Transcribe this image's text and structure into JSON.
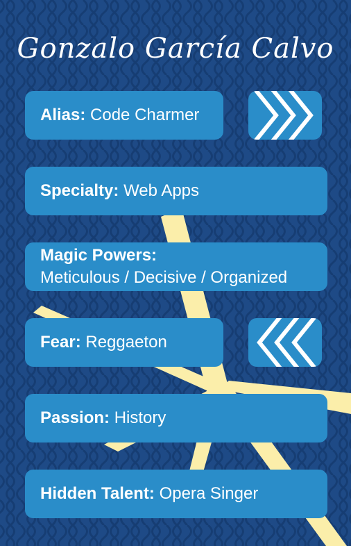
{
  "title": "Gonzalo García Calvo",
  "colors": {
    "background": "#1e4a86",
    "pattern": "#163d73",
    "card": "#2a8dc9",
    "stripe": "#fbeeaa",
    "text": "#ffffff"
  },
  "cards": [
    {
      "label": "Alias:",
      "value": "Code Charmer"
    },
    {
      "label": "Specialty:",
      "value": "Web Apps"
    },
    {
      "label": "Magic Powers:",
      "value": "Meticulous / Decisive / Organized"
    },
    {
      "label": "Fear:",
      "value": "Reggaeton"
    },
    {
      "label": "Passion:",
      "value": "History"
    },
    {
      "label": "Hidden Talent:",
      "value": "Opera Singer"
    }
  ],
  "icons": {
    "right": "chevrons-right-icon",
    "left": "chevrons-left-icon"
  }
}
